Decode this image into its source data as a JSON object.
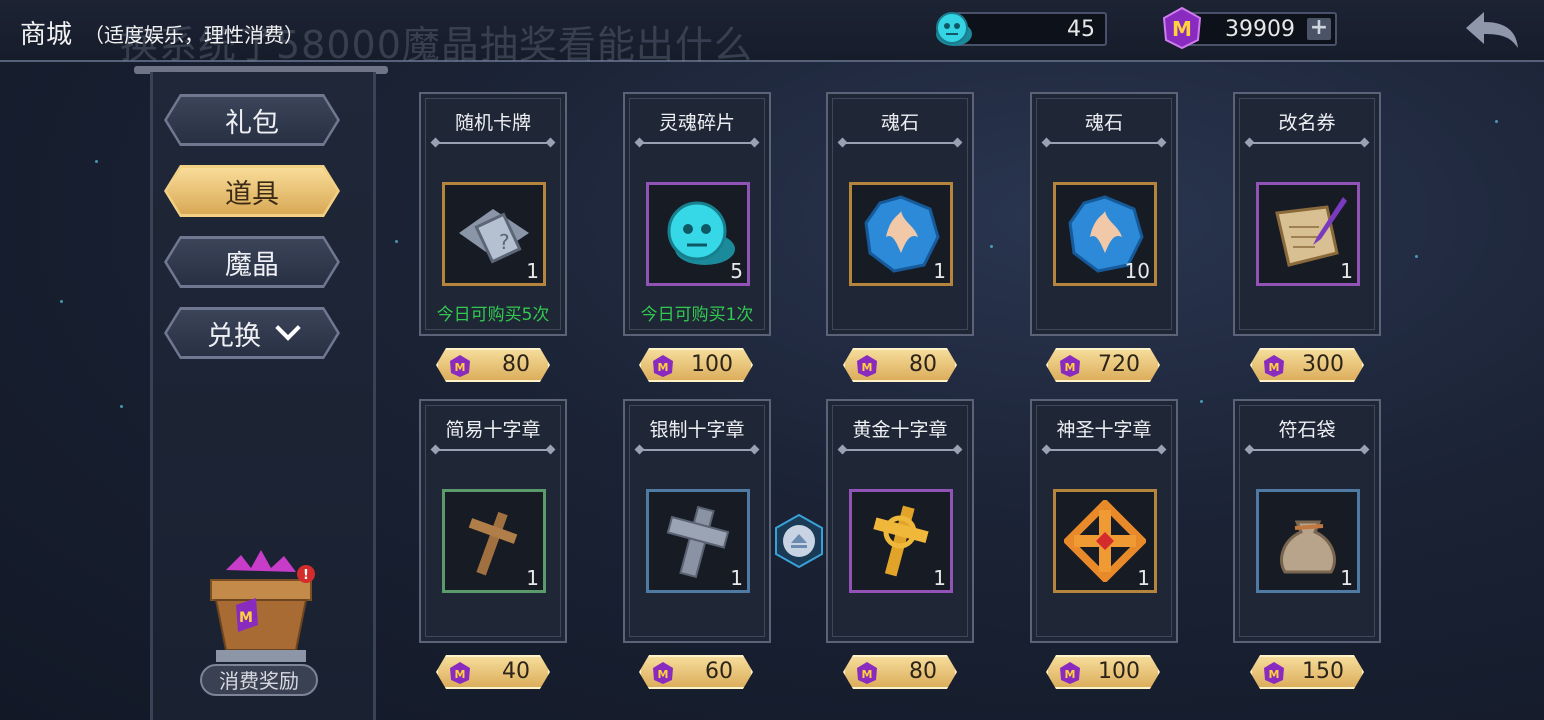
{
  "header": {
    "title": "商城",
    "subtitle": "（适度娱乐，理性消费）",
    "watermark": "换系统了58000魔晶抽奖看能出什么"
  },
  "currencies": [
    {
      "name": "soul-coin",
      "value": "45"
    },
    {
      "name": "magic-crystal",
      "value": "39909"
    }
  ],
  "tabs": [
    {
      "label": "礼包",
      "active": false
    },
    {
      "label": "道具",
      "active": true
    },
    {
      "label": "魔晶",
      "active": false
    },
    {
      "label": "兑换",
      "active": false
    }
  ],
  "reward_label": "消费奖励",
  "items": [
    {
      "name": "随机卡牌",
      "qty": "1",
      "limit": "今日可购买5次",
      "price": "80",
      "icon": "card-pack-icon"
    },
    {
      "name": "灵魂碎片",
      "qty": "5",
      "limit": "今日可购买1次",
      "price": "100",
      "icon": "soul-shard-icon"
    },
    {
      "name": "魂石",
      "qty": "1",
      "limit": "",
      "price": "80",
      "icon": "soul-stone-icon"
    },
    {
      "name": "魂石",
      "qty": "10",
      "limit": "",
      "price": "720",
      "icon": "soul-stone-icon"
    },
    {
      "name": "改名券",
      "qty": "1",
      "limit": "",
      "price": "300",
      "icon": "rename-scroll-icon"
    },
    {
      "name": "简易十字章",
      "qty": "1",
      "limit": "",
      "price": "40",
      "icon": "wooden-cross-icon"
    },
    {
      "name": "银制十字章",
      "qty": "1",
      "limit": "",
      "price": "60",
      "icon": "silver-cross-icon"
    },
    {
      "name": "黄金十字章",
      "qty": "1",
      "limit": "",
      "price": "80",
      "icon": "gold-cross-icon"
    },
    {
      "name": "神圣十字章",
      "qty": "1",
      "limit": "",
      "price": "100",
      "icon": "holy-cross-icon"
    },
    {
      "name": "符石袋",
      "qty": "1",
      "limit": "",
      "price": "150",
      "icon": "rune-bag-icon"
    }
  ]
}
